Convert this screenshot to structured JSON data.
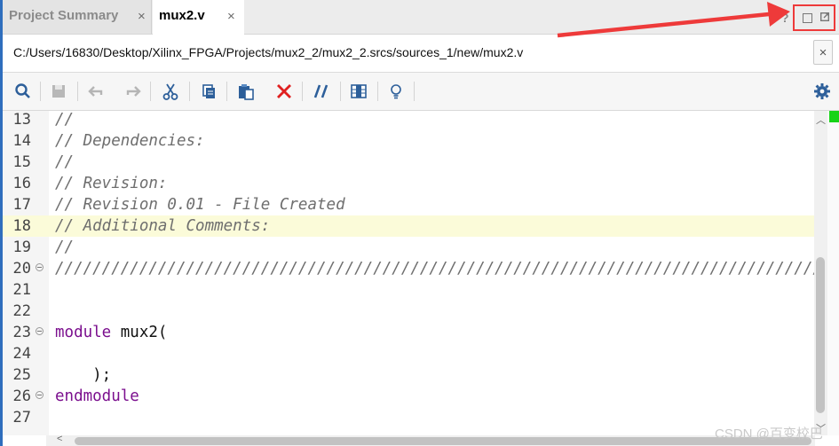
{
  "tabs": [
    {
      "label": "Project Summary",
      "active": false,
      "close": "×"
    },
    {
      "label": "mux2.v",
      "active": true,
      "close": "×"
    }
  ],
  "window_controls": {
    "help": "?",
    "icons": [
      "maximize-icon",
      "float-icon"
    ]
  },
  "file_path": "C:/Users/16830/Desktop/Xilinx_FPGA/Projects/mux2_2/mux2_2.srcs/sources_1/new/mux2.v",
  "path_close": "×",
  "toolbar": {
    "icons": [
      "search-icon",
      "save-icon",
      "undo-icon",
      "redo-icon",
      "cut-icon",
      "copy-icon",
      "paste-icon",
      "delete-icon",
      "comment-toggle-icon",
      "column-select-icon",
      "lightbulb-icon",
      "settings-gear-icon"
    ]
  },
  "editor": {
    "lines": [
      {
        "num": "13",
        "text": "//",
        "style": "comment"
      },
      {
        "num": "14",
        "text": "// Dependencies:",
        "style": "comment"
      },
      {
        "num": "15",
        "text": "//",
        "style": "comment"
      },
      {
        "num": "16",
        "text": "// Revision:",
        "style": "comment"
      },
      {
        "num": "17",
        "text": "// Revision 0.01 - File Created",
        "style": "comment"
      },
      {
        "num": "18",
        "text": "// Additional Comments:",
        "style": "comment",
        "highlight": true
      },
      {
        "num": "19",
        "text": "//",
        "style": "comment"
      },
      {
        "num": "20",
        "text": "//////////////////////////////////////////////////////////////////////////////////",
        "style": "comment",
        "fold": true
      },
      {
        "num": "21",
        "text": "",
        "style": "plain"
      },
      {
        "num": "22",
        "text": "",
        "style": "plain"
      },
      {
        "num": "23",
        "kw": "module",
        "text": " mux2(",
        "style": "plain",
        "fold": true
      },
      {
        "num": "24",
        "text": "",
        "style": "plain"
      },
      {
        "num": "25",
        "text": "    );",
        "style": "plain"
      },
      {
        "num": "26",
        "kw": "endmodule",
        "text": "",
        "style": "plain",
        "fold": true
      },
      {
        "num": "27",
        "text": "",
        "style": "plain"
      }
    ],
    "highlight_color": "#fbfbd9",
    "comment_color": "#6e6e6e",
    "keyword_color": "#7b0f8e"
  },
  "colors": {
    "accent": "#2f6ebd",
    "annotation_red": "#ee3a3a",
    "marker_green": "#17d317"
  },
  "watermark": "CSDN @百变校巴"
}
